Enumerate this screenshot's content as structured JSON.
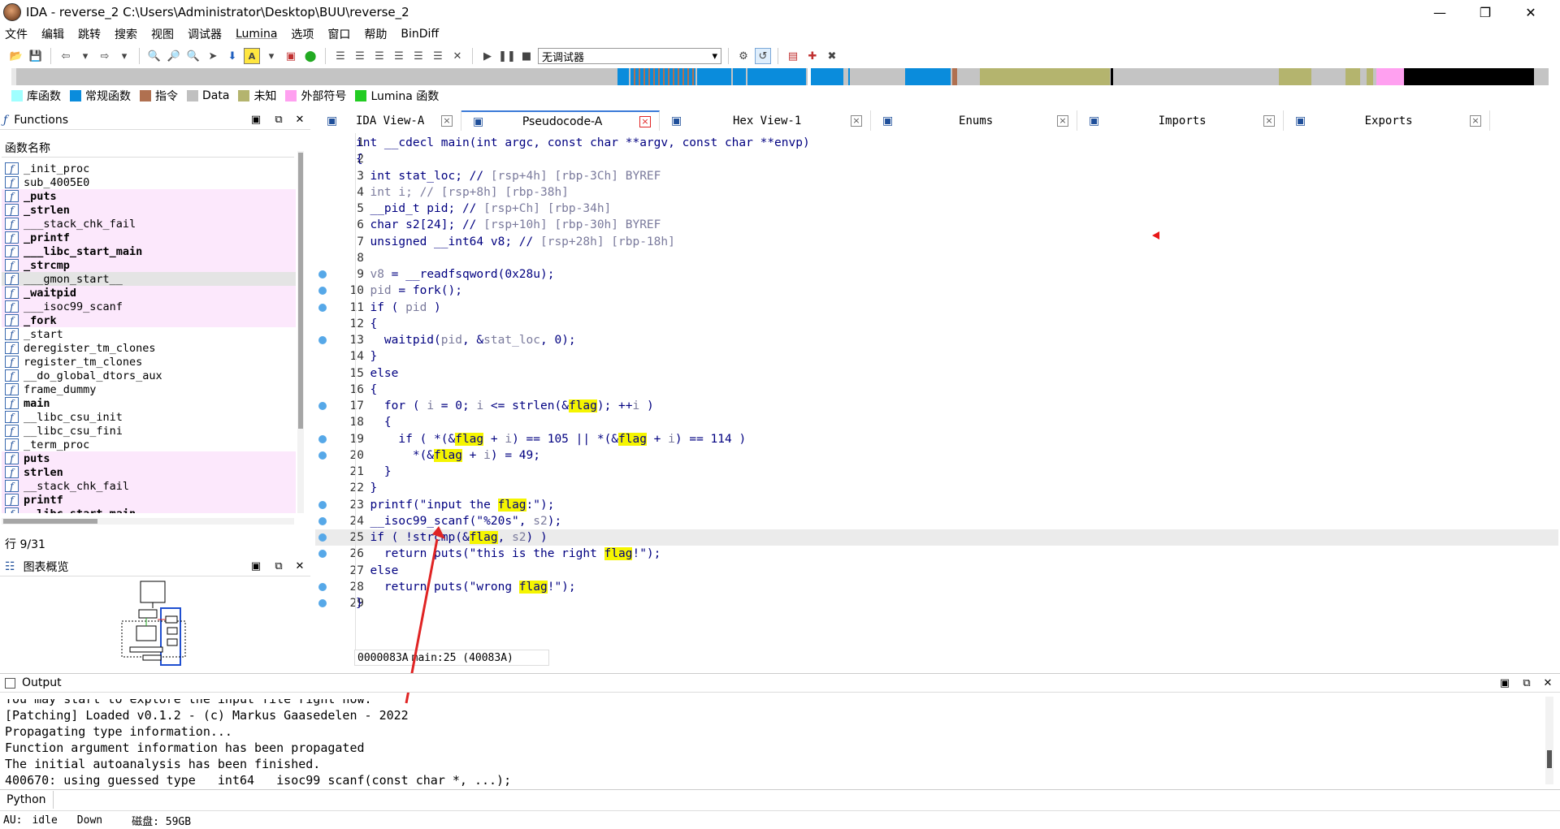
{
  "window": {
    "title": "IDA - reverse_2 C:\\Users\\Administrator\\Desktop\\BUU\\reverse_2"
  },
  "menu": [
    "文件",
    "编辑",
    "跳转",
    "搜索",
    "视图",
    "调试器",
    "Lumina",
    "选项",
    "窗口",
    "帮助",
    "BinDiff"
  ],
  "toolbar": {
    "debugger_select": "无调试器"
  },
  "legend": [
    {
      "label": "库函数",
      "color": "#a0ffff"
    },
    {
      "label": "常规函数",
      "color": "#0a8cdc"
    },
    {
      "label": "指令",
      "color": "#b07050"
    },
    {
      "label": "Data",
      "color": "#c0c0c0"
    },
    {
      "label": "未知",
      "color": "#b4b46e"
    },
    {
      "label": "外部符号",
      "color": "#ffa0f0"
    },
    {
      "label": "Lumina 函数",
      "color": "#22cc22"
    }
  ],
  "functions_panel": {
    "title": "Functions",
    "column": "函数名称",
    "status": "行 9/31",
    "items": [
      {
        "name": "_init_proc",
        "lib": false,
        "bold": false
      },
      {
        "name": "sub_4005E0",
        "lib": false,
        "bold": false
      },
      {
        "name": "_puts",
        "lib": true,
        "bold": true
      },
      {
        "name": "_strlen",
        "lib": true,
        "bold": true
      },
      {
        "name": "___stack_chk_fail",
        "lib": true,
        "bold": false
      },
      {
        "name": "_printf",
        "lib": true,
        "bold": true
      },
      {
        "name": "___libc_start_main",
        "lib": true,
        "bold": true
      },
      {
        "name": "_strcmp",
        "lib": true,
        "bold": true
      },
      {
        "name": "___gmon_start__",
        "lib": true,
        "bold": false,
        "sel": true
      },
      {
        "name": "_waitpid",
        "lib": true,
        "bold": true
      },
      {
        "name": "___isoc99_scanf",
        "lib": true,
        "bold": false
      },
      {
        "name": "_fork",
        "lib": true,
        "bold": true
      },
      {
        "name": "_start",
        "lib": false,
        "bold": false
      },
      {
        "name": "deregister_tm_clones",
        "lib": false,
        "bold": false
      },
      {
        "name": "register_tm_clones",
        "lib": false,
        "bold": false
      },
      {
        "name": "__do_global_dtors_aux",
        "lib": false,
        "bold": false
      },
      {
        "name": "frame_dummy",
        "lib": false,
        "bold": false
      },
      {
        "name": "main",
        "lib": false,
        "bold": true
      },
      {
        "name": "__libc_csu_init",
        "lib": false,
        "bold": false
      },
      {
        "name": "__libc_csu_fini",
        "lib": false,
        "bold": false
      },
      {
        "name": "_term_proc",
        "lib": false,
        "bold": false
      },
      {
        "name": "puts",
        "lib": true,
        "bold": true
      },
      {
        "name": "strlen",
        "lib": true,
        "bold": true
      },
      {
        "name": "__stack_chk_fail",
        "lib": true,
        "bold": false
      },
      {
        "name": "printf",
        "lib": true,
        "bold": true
      },
      {
        "name": "__libc_start_main",
        "lib": true,
        "bold": true
      }
    ]
  },
  "graph_panel": {
    "title": "图表概览"
  },
  "tabs": [
    {
      "label": "IDA View-A",
      "active": false
    },
    {
      "label": "Pseudocode-A",
      "active": true
    },
    {
      "label": "Hex View-1",
      "active": false
    },
    {
      "label": "Enums",
      "active": false
    },
    {
      "label": "Imports",
      "active": false
    },
    {
      "label": "Exports",
      "active": false
    }
  ],
  "code": [
    {
      "n": "1",
      "dot": false,
      "cur": false,
      "html": "int __cdecl main(int argc, const char **argv, const char **envp)"
    },
    {
      "n": "2",
      "dot": false,
      "cur": false,
      "html": "{"
    },
    {
      "n": "3",
      "dot": false,
      "cur": false,
      "html": "  int stat_loc; // <span class='gray'>[rsp+4h] [rbp-3Ch] BYREF</span>"
    },
    {
      "n": "4",
      "dot": false,
      "cur": false,
      "html": "  <span class='gray'>int i; // [rsp+8h] [rbp-38h]</span>"
    },
    {
      "n": "5",
      "dot": false,
      "cur": false,
      "html": "  __pid_t pid; // <span class='gray'>[rsp+Ch] [rbp-34h]</span>"
    },
    {
      "n": "6",
      "dot": false,
      "cur": false,
      "html": "  char s2[24]; // <span class='gray'>[rsp+10h] [rbp-30h] BYREF</span>"
    },
    {
      "n": "7",
      "dot": false,
      "cur": false,
      "html": "  unsigned __int64 v8; // <span class='gray'>[rsp+28h] [rbp-18h]</span>"
    },
    {
      "n": "8",
      "dot": false,
      "cur": false,
      "html": ""
    },
    {
      "n": "9",
      "dot": true,
      "cur": false,
      "html": "  <span class='gray'>v8</span> = __readfsqword(0x28u);"
    },
    {
      "n": "10",
      "dot": true,
      "cur": false,
      "html": "  <span class='gray'>pid</span> = fork();"
    },
    {
      "n": "11",
      "dot": true,
      "cur": false,
      "html": "  if ( <span class='gray'>pid</span> )"
    },
    {
      "n": "12",
      "dot": false,
      "cur": false,
      "html": "  {"
    },
    {
      "n": "13",
      "dot": true,
      "cur": false,
      "html": "    waitpid(<span class='gray'>pid</span>, &amp;<span class='gray'>stat_loc</span>, 0);"
    },
    {
      "n": "14",
      "dot": false,
      "cur": false,
      "html": "  }"
    },
    {
      "n": "15",
      "dot": false,
      "cur": false,
      "html": "  else"
    },
    {
      "n": "16",
      "dot": false,
      "cur": false,
      "html": "  {"
    },
    {
      "n": "17",
      "dot": true,
      "cur": false,
      "html": "    for ( <span class='gray'>i</span> = 0; <span class='gray'>i</span> &lt;= strlen(&amp;<span class='hl'>flag</span>); ++<span class='gray'>i</span> )"
    },
    {
      "n": "18",
      "dot": false,
      "cur": false,
      "html": "    {"
    },
    {
      "n": "19",
      "dot": true,
      "cur": false,
      "html": "      if ( *(&amp;<span class='hl'>flag</span> + <span class='gray'>i</span>) == 105 || *(&amp;<span class='hl'>flag</span> + <span class='gray'>i</span>) == 114 )"
    },
    {
      "n": "20",
      "dot": true,
      "cur": false,
      "html": "        *(&amp;<span class='hl'>flag</span> + <span class='gray'>i</span>) = 49;"
    },
    {
      "n": "21",
      "dot": false,
      "cur": false,
      "html": "    }"
    },
    {
      "n": "22",
      "dot": false,
      "cur": false,
      "html": "  }"
    },
    {
      "n": "23",
      "dot": true,
      "cur": false,
      "html": "  printf(\"input the <span class='hl'>flag</span>:\");"
    },
    {
      "n": "24",
      "dot": true,
      "cur": false,
      "html": "  __isoc99_scanf(\"%20s\", <span class='gray'>s2</span>);"
    },
    {
      "n": "25",
      "dot": true,
      "cur": true,
      "html": "  if ( !strcmp(&amp;<span class='hl'>flag</span>, <span class='gray'>s2</span>) )"
    },
    {
      "n": "26",
      "dot": true,
      "cur": false,
      "html": "    return puts(\"this is the right <span class='hl'>flag</span>!\");"
    },
    {
      "n": "27",
      "dot": false,
      "cur": false,
      "html": "  else"
    },
    {
      "n": "28",
      "dot": true,
      "cur": false,
      "html": "    return puts(\"wrong <span class='hl'>flag</span>!\");"
    },
    {
      "n": "29",
      "dot": true,
      "cur": false,
      "html": "}"
    }
  ],
  "editor_status": {
    "address": "0000083A",
    "location": "main:25 (40083A)"
  },
  "output_panel": {
    "title": "Output",
    "lines": [
      "You may start to explore the input file right now.",
      "[Patching] Loaded v0.1.2 - (c) Markus Gaasedelen - 2022",
      "Propagating type information...",
      "Function argument information has been propagated",
      "The initial autoanalysis has been finished.",
      "400670: using guessed type __int64 __isoc99_scanf(const char *, ...);"
    ]
  },
  "python_label": "Python",
  "status": {
    "au_label": "AU:",
    "au_state": "idle",
    "direction": "Down",
    "disk": "磁盘: 59GB"
  }
}
